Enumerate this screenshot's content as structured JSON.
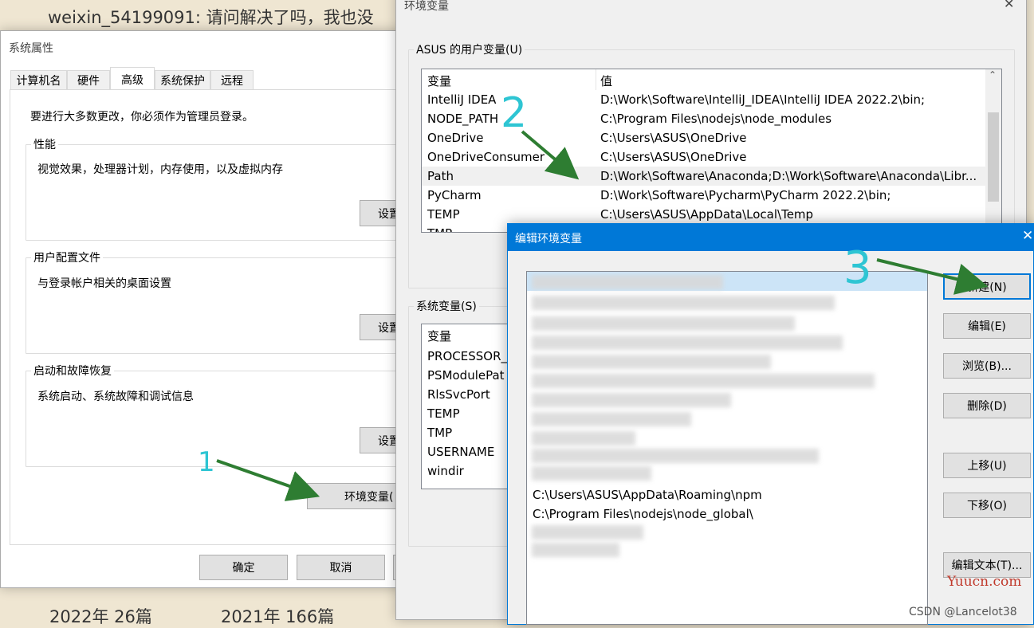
{
  "background": {
    "comment_text": "weixin_54199091: 请问解决了吗，我也没",
    "year_2022": "2022年  26篇",
    "year_2021": "2021年  166篇",
    "watermark_yuucn": "Yuucn.com",
    "watermark_csdn": "CSDN @Lancelot38"
  },
  "sysprops": {
    "title": "系统属性",
    "tabs": [
      "计算机名",
      "硬件",
      "高级",
      "系统保护",
      "远程"
    ],
    "admin_note": "要进行大多数更改，你必须作为管理员登录。",
    "perf": {
      "label": "性能",
      "desc": "视觉效果，处理器计划，内存使用，以及虚拟内存",
      "button": "设置"
    },
    "profile": {
      "label": "用户配置文件",
      "desc": "与登录帐户相关的桌面设置",
      "button": "设置"
    },
    "startup": {
      "label": "启动和故障恢复",
      "desc": "系统启动、系统故障和调试信息",
      "button": "设置"
    },
    "env_button": "环境变量(",
    "ok": "确定",
    "cancel": "取消"
  },
  "envvars": {
    "title": "环境变量",
    "user_group": "ASUS 的用户变量(U)",
    "header_var": "变量",
    "header_val": "值",
    "user_rows": [
      {
        "name": "IntelliJ IDEA",
        "value": "D:\\Work\\Software\\IntelliJ_IDEA\\IntelliJ IDEA 2022.2\\bin;"
      },
      {
        "name": "NODE_PATH",
        "value": "C:\\Program Files\\nodejs\\node_modules"
      },
      {
        "name": "OneDrive",
        "value": "C:\\Users\\ASUS\\OneDrive"
      },
      {
        "name": "OneDriveConsumer",
        "value": "C:\\Users\\ASUS\\OneDrive"
      },
      {
        "name": "Path",
        "value": "D:\\Work\\Software\\Anaconda;D:\\Work\\Software\\Anaconda\\Libr..."
      },
      {
        "name": "PyCharm",
        "value": "D:\\Work\\Software\\Pycharm\\PyCharm 2022.2\\bin;"
      },
      {
        "name": "TEMP",
        "value": "C:\\Users\\ASUS\\AppData\\Local\\Temp"
      },
      {
        "name": "TMP",
        "value": ""
      }
    ],
    "sys_group": "系统变量(S)",
    "sys_rows": [
      "PROCESSOR_",
      "PSModulePat",
      "RlsSvcPort",
      "TEMP",
      "TMP",
      "USERNAME",
      "windir"
    ]
  },
  "editenv": {
    "title": "编辑环境变量",
    "visible_paths": [
      "C:\\Users\\ASUS\\AppData\\Roaming\\npm",
      "C:\\Program Files\\nodejs\\node_global\\"
    ],
    "buttons": {
      "new": "新建(N)",
      "edit": "编辑(E)",
      "browse": "浏览(B)...",
      "delete": "删除(D)",
      "up": "上移(U)",
      "down": "下移(O)",
      "edit_text": "编辑文本(T)..."
    }
  },
  "annotations": {
    "step1": "1",
    "step2": "2",
    "step3": "3"
  },
  "colors": {
    "arrow": "#2e7d32",
    "annotation": "#2ec5d3",
    "accent": "#0078d7"
  }
}
